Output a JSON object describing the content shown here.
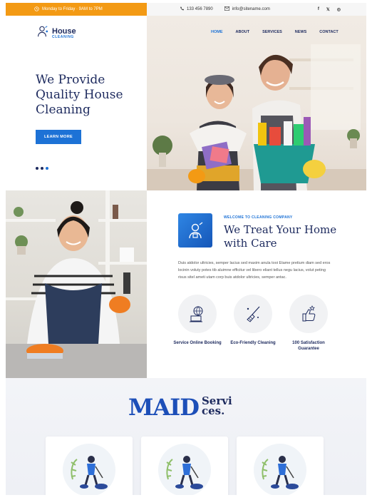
{
  "topbar": {
    "hours": "Monday to Friday · 9AM to 7PM",
    "phone": "133 456 7890",
    "email": "info@sitename.com",
    "social": [
      "f",
      "𝕏",
      "◎"
    ]
  },
  "logo": {
    "main": "House",
    "sub": "CLEANING"
  },
  "nav": {
    "items": [
      "HOME",
      "ABOUT",
      "SERVICES",
      "NEWS",
      "CONTACT"
    ],
    "active": "HOME"
  },
  "hero": {
    "title_line1": "We Provide",
    "title_line2": "Quality House",
    "title_line3": "Cleaning",
    "button": "LEARN MORE"
  },
  "about": {
    "welcome": "WELCOME TO CLEANING COMPANY",
    "title_line1": "We Treat Your Home",
    "title_line2": "with Care",
    "paragraph": "Duis atdolor ultricies, semper lacius sed maxim anula tooi Etame pretium diam sed eros locinin voluty potes tib aluimne efficitur vel libero eliant tellus negu lacius, volut peting risus sitel ameti utam corp buis atdolor ultricies, semper antac.",
    "features": [
      {
        "label": "Service Online Booking",
        "icon": "globe-laptop-icon"
      },
      {
        "label": "Eco-Friendly Cleaning",
        "icon": "broom-icon"
      },
      {
        "label": "100 Satisfaction Guarantee",
        "icon": "thumbs-up-icon"
      }
    ]
  },
  "services": {
    "title_big": "MAID",
    "title_small_1": "Servi",
    "title_small_2": "ces."
  },
  "colors": {
    "accent": "#1d72d6",
    "orange": "#f39a14",
    "navy": "#1d2a5e"
  }
}
